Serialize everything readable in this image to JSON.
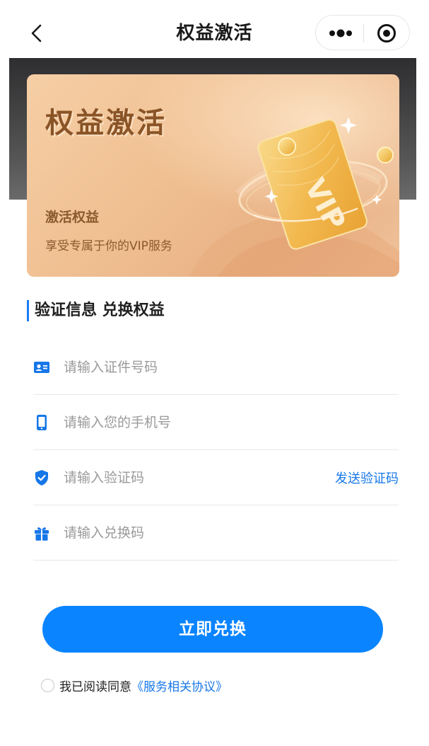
{
  "navbar": {
    "title": "权益激活",
    "back_icon": "chevron-left-icon",
    "more_icon": "more-dots-icon",
    "close_icon": "target-close-icon"
  },
  "banner": {
    "title": "权益激活",
    "subtitle": "激活权益",
    "description": "享受专属于你的VIP服务",
    "vip_card_text": "VIP"
  },
  "section": {
    "title": "验证信息 兑换权益"
  },
  "form": {
    "id_number": {
      "placeholder": "请输入证件号码",
      "value": "",
      "icon": "id-card-icon"
    },
    "phone": {
      "placeholder": "请输入您的手机号",
      "value": "",
      "icon": "phone-icon"
    },
    "code": {
      "placeholder": "请输入验证码",
      "value": "",
      "icon": "shield-check-icon",
      "send_label": "发送验证码"
    },
    "redeem_code": {
      "placeholder": "请输入兑换码",
      "value": "",
      "icon": "gift-icon"
    }
  },
  "submit": {
    "label": "立即兑换"
  },
  "agreement": {
    "text": "我已阅读同意",
    "link": "《服务相关协议》",
    "checked": false
  },
  "colors": {
    "accent": "#0a84ff",
    "link": "#1677e8",
    "banner_text": "#8a5426"
  }
}
